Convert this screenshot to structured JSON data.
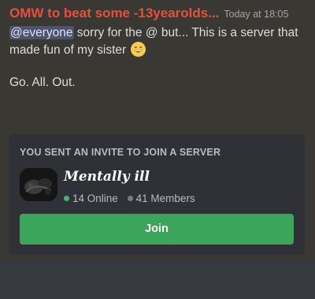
{
  "message": {
    "username": "OMW to beat some -13yearolds...",
    "timestamp": "Today at 18:05",
    "mention": "@everyone",
    "text_part1": " sorry for the @ but... This is a server that made fun of my sister",
    "emoji": "grinning-face-emoji",
    "line2": "Go. All. Out."
  },
  "invite": {
    "heading": "YOU SENT AN INVITE TO JOIN A SERVER",
    "server_name": "Mentally ill",
    "online_count": "14 Online",
    "member_count": "41 Members",
    "join_label": "Join"
  },
  "colors": {
    "username": "#e84f3f",
    "online": "#43b581",
    "join": "#3ba55c"
  }
}
